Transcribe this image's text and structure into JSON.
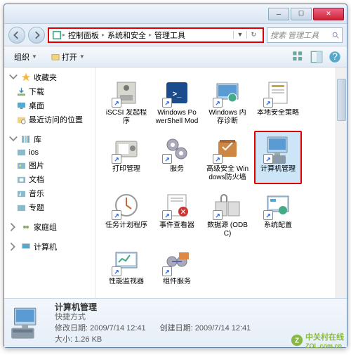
{
  "titlebar": {
    "min": "─",
    "max": "☐",
    "close": "✕"
  },
  "breadcrumb": [
    "控制面板",
    "系统和安全",
    "管理工具"
  ],
  "address": {
    "dropdown": "▼",
    "refresh": "↻"
  },
  "search": {
    "placeholder": "搜索 管理工具"
  },
  "toolbar": {
    "organize": "组织",
    "open": "打开",
    "dropdown": "▼"
  },
  "sidebar": {
    "favorites": {
      "label": "收藏夹",
      "items": [
        "下载",
        "桌面",
        "最近访问的位置"
      ]
    },
    "libraries": {
      "label": "库",
      "items": [
        "ios",
        "图片",
        "文档",
        "音乐",
        "专题"
      ]
    },
    "homegroup": {
      "label": "家庭组"
    },
    "computer": {
      "label": "计算机"
    }
  },
  "icons": [
    {
      "label": "iSCSI 发起程序"
    },
    {
      "label": "Windows PowerShell Modules"
    },
    {
      "label": "Windows 内存诊断"
    },
    {
      "label": "本地安全策略"
    },
    {
      "label": "打印管理"
    },
    {
      "label": "服务"
    },
    {
      "label": "高级安全 Windows防火墙"
    },
    {
      "label": "计算机管理",
      "sel": true,
      "hl": true
    },
    {
      "label": "任务计划程序"
    },
    {
      "label": "事件查看器"
    },
    {
      "label": "数据源 (ODBC)"
    },
    {
      "label": "系统配置"
    },
    {
      "label": "性能监视器"
    },
    {
      "label": "组件服务"
    }
  ],
  "details": {
    "name": "计算机管理",
    "type": "快捷方式",
    "modified_label": "修改日期:",
    "modified": "2009/7/14 12:41",
    "size_label": "大小:",
    "size": "1.26 KB",
    "created_label": "创建日期:",
    "created": "2009/7/14 12:41"
  },
  "watermark": {
    "text": "中关村在线",
    "url": "ZOL.com.cn"
  }
}
